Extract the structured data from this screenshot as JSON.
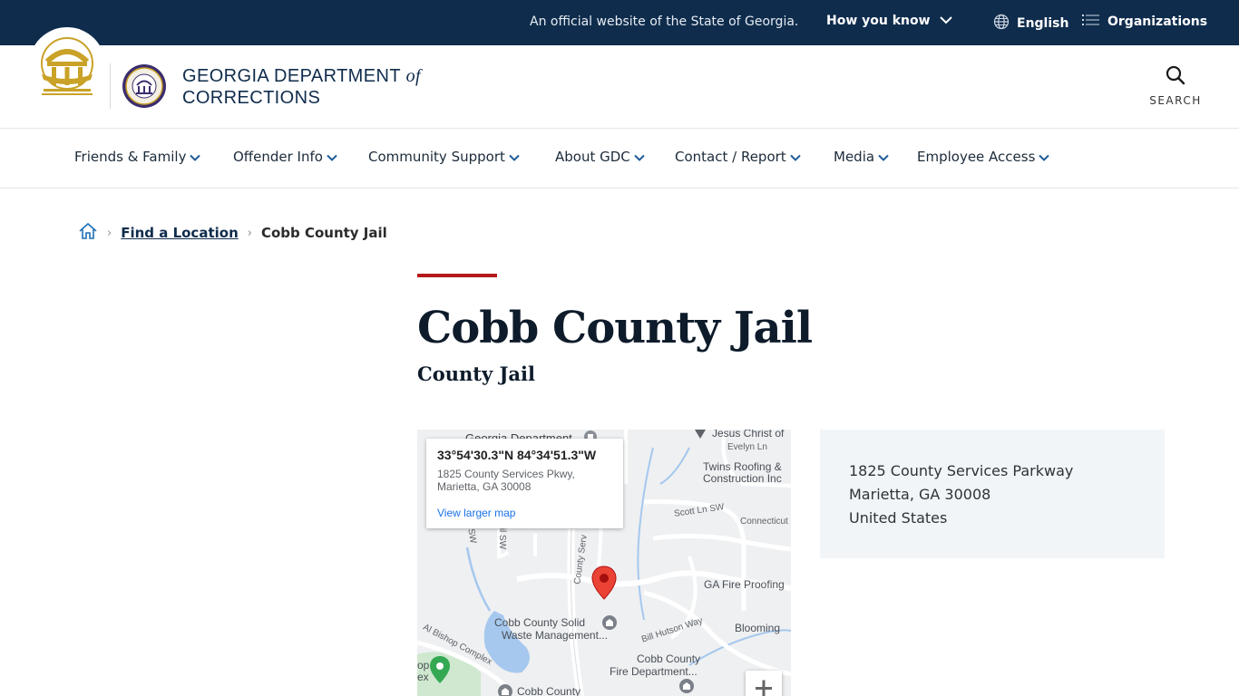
{
  "banner": {
    "official": "An official website of the State of Georgia.",
    "how_you_know": "How you know",
    "language": "English",
    "organizations": "Organizations"
  },
  "header": {
    "dept_line1": "GEORGIA DEPARTMENT",
    "dept_of": "of",
    "dept_line2": "CORRECTIONS",
    "search_label": "SEARCH"
  },
  "nav": {
    "items": [
      {
        "label": "Friends & Family"
      },
      {
        "label": "Offender Info"
      },
      {
        "label": "Community Support"
      },
      {
        "label": "About GDC"
      },
      {
        "label": "Contact / Report"
      },
      {
        "label": "Media"
      },
      {
        "label": "Employee Access"
      }
    ]
  },
  "breadcrumb": {
    "parent": "Find a Location",
    "current": "Cobb County Jail"
  },
  "page": {
    "title": "Cobb County Jail",
    "subtitle": "County Jail"
  },
  "map": {
    "coords": "33°54'30.3\"N 84°34'51.3\"W",
    "address": "1825 County Services Pkwy, Marietta, GA 30008",
    "view_larger": "View larger map",
    "labels": {
      "georgia_dept": "Georgia Department",
      "jesus_christ": "Jesus Christ of",
      "evelyn_ln": "Evelyn Ln",
      "twins_roofing_1": "Twins Roofing &",
      "twins_roofing_2": "Construction Inc",
      "scott_ln": "Scott Ln SW",
      "connecticut": "Connecticut",
      "county_serv": "County Serv",
      "ga_fire": "GA Fire Proofing",
      "solid_waste_1": "Cobb County Solid",
      "solid_waste_2": "Waste Management...",
      "bill_hutson": "Bill Hutson Way",
      "blooming": "Blooming",
      "al_bishop": "Al Bishop Complex",
      "fire_dept_1": "Cobb County",
      "fire_dept_2": "Fire Department...",
      "cobb_county_bottom": "Cobb County",
      "sw1": "SW",
      "sw2": "il SW",
      "op": "op",
      "ex": "ex"
    }
  },
  "address_box": {
    "line1": "1825 County Services Parkway",
    "line2": "Marietta, GA 30008",
    "line3": "United States"
  },
  "colors": {
    "banner_bg": "#0f2c4c",
    "accent_red": "#b31b1b",
    "gold": "#c9a227",
    "pin_red": "#ea4335"
  }
}
